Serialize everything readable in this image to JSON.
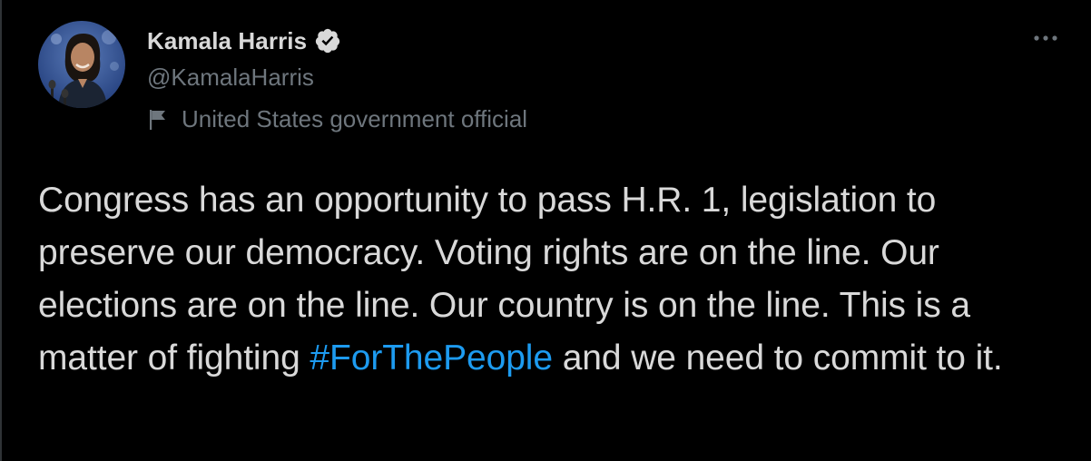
{
  "author": {
    "display_name": "Kamala Harris",
    "handle": "@KamalaHarris",
    "label": "United States government official",
    "verified": true
  },
  "tweet": {
    "text_before": "Congress has an opportunity to pass H.R. 1, legislation to preserve our democracy. Voting rights are on the line. Our elections are on the line. Our country is on the line. This is a matter of fighting ",
    "hashtag": "#ForThePeople",
    "text_after": " and we need to commit to it."
  },
  "icons": {
    "verified": "verified-badge-icon",
    "label": "flag-icon",
    "more": "more-options-icon"
  },
  "colors": {
    "background": "#000000",
    "text": "#d9d9d9",
    "secondary": "#6e767d",
    "link": "#1d9bf0"
  }
}
